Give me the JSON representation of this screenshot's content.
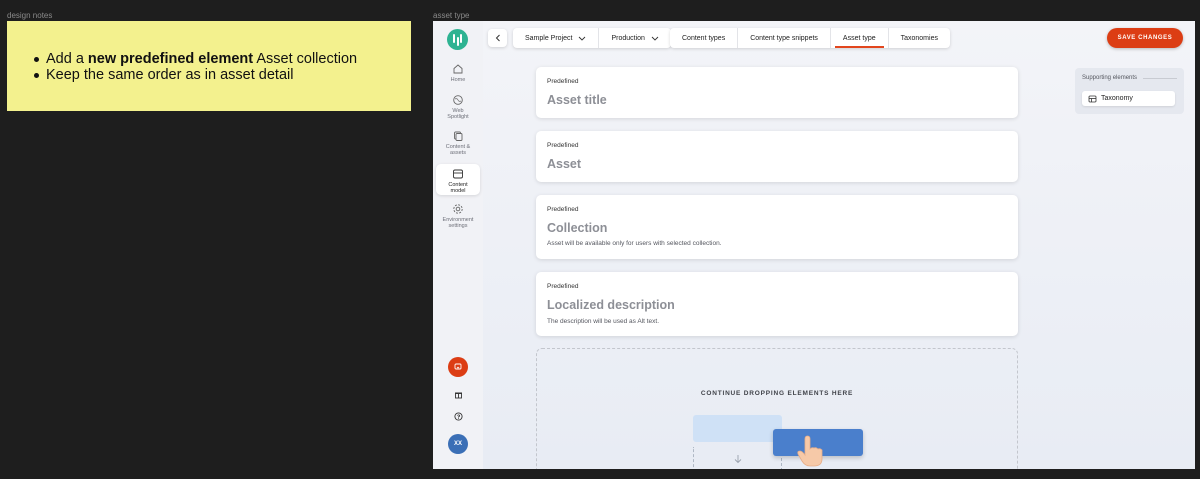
{
  "canvas": {
    "notes_frame_label": "design notes",
    "app_frame_label": "asset type"
  },
  "note": {
    "items": [
      {
        "before": "Add a ",
        "bold": "new predefined element",
        "after": " Asset collection"
      },
      {
        "text": "Keep the same order as in asset detail"
      }
    ]
  },
  "sidebar": {
    "items": [
      {
        "label": "Home",
        "icon": "home-icon"
      },
      {
        "label": "Web Spotlight",
        "icon": "globe-icon"
      },
      {
        "label": "Content & assets",
        "icon": "content-icon"
      },
      {
        "label": "Content model",
        "icon": "model-icon",
        "active": true
      },
      {
        "label": "Environment settings",
        "icon": "gear-icon"
      }
    ],
    "bottom": {
      "notifications_icon": "chat-icon",
      "gift_icon": "gift-icon",
      "help_icon": "help-icon",
      "avatar_initials": "XX"
    }
  },
  "topbar": {
    "project": "Sample Project",
    "environment": "Production",
    "tabs": [
      "Content types",
      "Content type snippets",
      "Asset type",
      "Taxonomies"
    ],
    "active_tab": "Asset type",
    "save_label": "SAVE CHANGES"
  },
  "elements": [
    {
      "tag": "Predefined",
      "title": "Asset title",
      "hint": ""
    },
    {
      "tag": "Predefined",
      "title": "Asset",
      "hint": ""
    },
    {
      "tag": "Predefined",
      "title": "Collection",
      "hint": "Asset will be available only for users with selected collection."
    },
    {
      "tag": "Predefined",
      "title": "Localized description",
      "hint": "The description will be used as Alt text."
    }
  ],
  "dropzone": {
    "label": "CONTINUE DROPPING ELEMENTS HERE"
  },
  "supporting": {
    "title": "Supporting elements",
    "items": [
      "Taxonomy"
    ]
  },
  "colors": {
    "accent": "#dc3d14",
    "logo": "#2eb392",
    "note": "#f3f18e",
    "avatar": "#3b6fb6",
    "drag_card": "#4a7fcc"
  }
}
